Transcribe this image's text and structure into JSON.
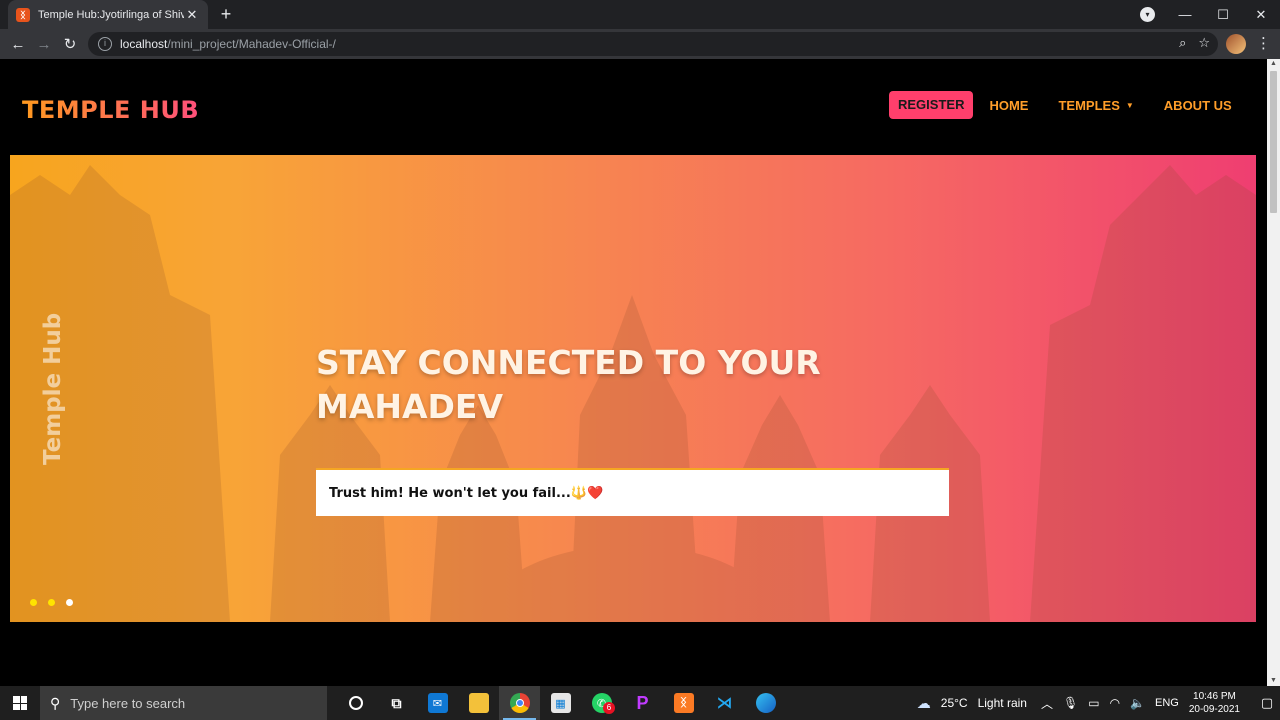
{
  "browser": {
    "tab_title": "Temple Hub:Jyotirlinga of Shiva",
    "tab_favicon": "xampp-favicon",
    "new_tab_label": "+",
    "url_host": "localhost",
    "url_path": "/mini_project/Mahadev-Official-/",
    "controls": {
      "back": "←",
      "forward": "→",
      "reload": "↻",
      "zoom": "⌕",
      "bookmark": "☆",
      "menu": "⋮",
      "close_tab": "✕"
    },
    "window": {
      "minimize": "—",
      "maximize": "☐",
      "close": "✕"
    }
  },
  "site": {
    "brand": "TEMPLE HUB",
    "nav": {
      "register": "REGISTER",
      "home": "HOME",
      "temples": "TEMPLES",
      "about": "ABOUT US"
    },
    "hero": {
      "side_label": "Temple Hub",
      "headline": "STAY CONNECTED TO YOUR MAHADEV",
      "quote": "Trust him! He won't let you fail...🔱❤️",
      "slide_count": 3,
      "active_slide": 3
    },
    "colors": {
      "brand_gradient_start": "#ff9a1f",
      "brand_gradient_end": "#ff4f7b",
      "register_bg": "#ff3f6c",
      "nav_link": "#ff9e2a",
      "dot_inactive": "#ffe400",
      "dot_active": "#ffffff"
    }
  },
  "taskbar": {
    "search_placeholder": "Type here to search",
    "weather_temp": "25°C",
    "weather_desc": "Light rain",
    "language": "ENG",
    "time": "10:46 PM",
    "date": "20-09-2021",
    "whatsapp_badge": "6",
    "pinned": [
      "cortana-icon",
      "task-view-icon",
      "mail-icon",
      "file-explorer-icon",
      "chrome-icon",
      "store-icon",
      "whatsapp-icon",
      "picsart-icon",
      "xampp-icon",
      "vscode-icon",
      "edge-icon"
    ]
  }
}
